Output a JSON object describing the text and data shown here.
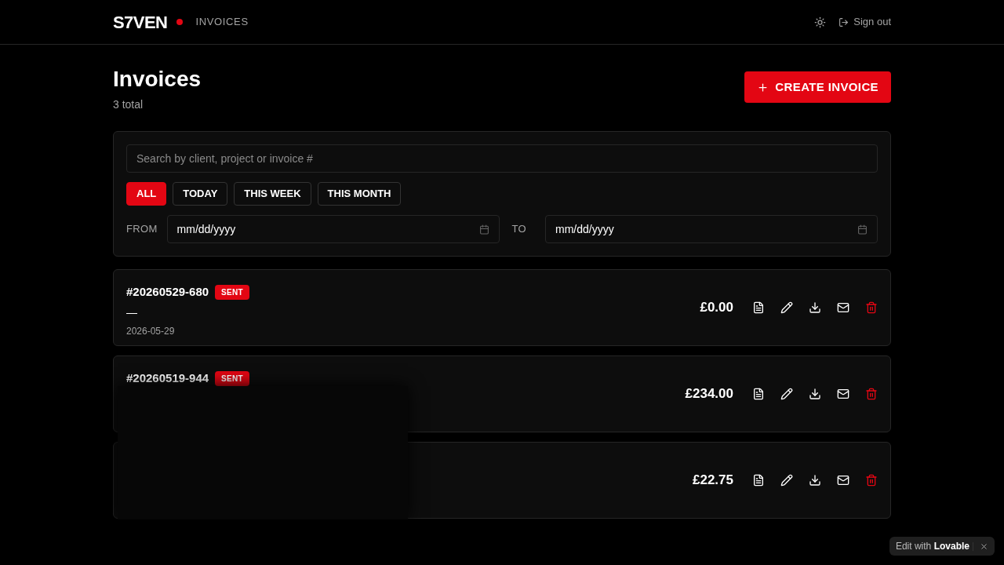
{
  "header": {
    "logo": "S7VEN",
    "section": "INVOICES",
    "sign_out": "Sign out"
  },
  "page": {
    "title": "Invoices",
    "count": "3 total",
    "create_button": "CREATE INVOICE"
  },
  "filters": {
    "search_placeholder": "Search by client, project or invoice #",
    "periods": [
      {
        "label": "ALL",
        "selected": true
      },
      {
        "label": "TODAY",
        "selected": false
      },
      {
        "label": "THIS WEEK",
        "selected": false
      },
      {
        "label": "THIS MONTH",
        "selected": false
      }
    ],
    "from_label": "FROM",
    "from_placeholder": "mm/dd/yyyy",
    "to_label": "TO",
    "to_placeholder": "mm/dd/yyyy"
  },
  "invoices": [
    {
      "number": "#20260529-680",
      "status": "SENT",
      "client": "—",
      "date": "2026-05-29",
      "amount": "£0.00"
    },
    {
      "number": "#20260519-944",
      "status": "SENT",
      "amount": "£234.00"
    },
    {
      "amount": "£22.75"
    }
  ],
  "lovable_badge": {
    "prefix": "Edit with",
    "brand": "Lovable"
  }
}
